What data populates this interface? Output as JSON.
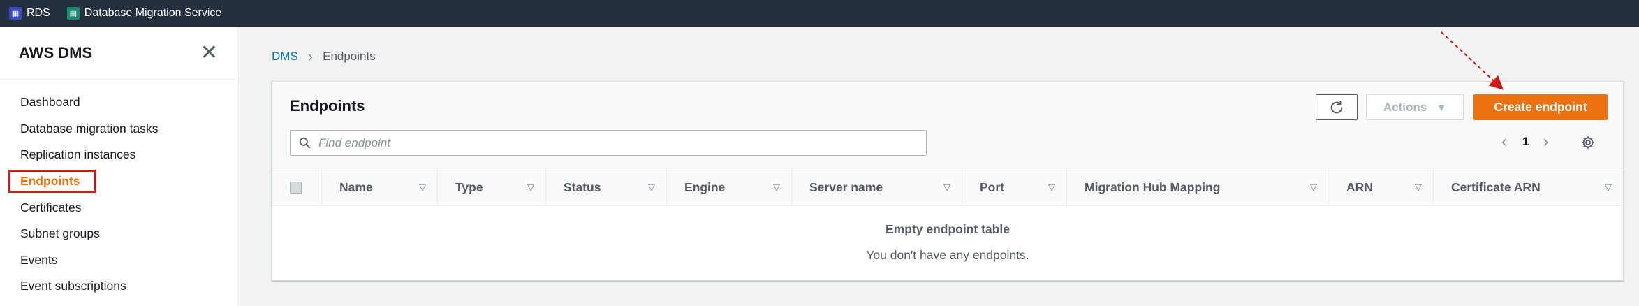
{
  "topbar": {
    "services": [
      {
        "label": "RDS",
        "icon": "rds-icon"
      },
      {
        "label": "Database Migration Service",
        "icon": "dms-icon"
      }
    ]
  },
  "sidebar": {
    "title": "AWS DMS",
    "items": [
      {
        "label": "Dashboard"
      },
      {
        "label": "Database migration tasks"
      },
      {
        "label": "Replication instances"
      },
      {
        "label": "Endpoints",
        "active": true
      },
      {
        "label": "Certificates"
      },
      {
        "label": "Subnet groups"
      },
      {
        "label": "Events"
      },
      {
        "label": "Event subscriptions"
      }
    ]
  },
  "breadcrumb": {
    "root": "DMS",
    "current": "Endpoints"
  },
  "panel": {
    "title": "Endpoints",
    "actions_label": "Actions",
    "create_label": "Create endpoint",
    "search_placeholder": "Find endpoint",
    "page": "1",
    "columns": [
      "Name",
      "Type",
      "Status",
      "Engine",
      "Server name",
      "Port",
      "Migration Hub Mapping",
      "ARN",
      "Certificate ARN"
    ],
    "empty_title": "Empty endpoint table",
    "empty_sub": "You don't have any endpoints."
  },
  "colors": {
    "accent": "#ec7211",
    "topbar": "#232f3e",
    "link": "#0073bb",
    "highlight": "#d1191a"
  }
}
